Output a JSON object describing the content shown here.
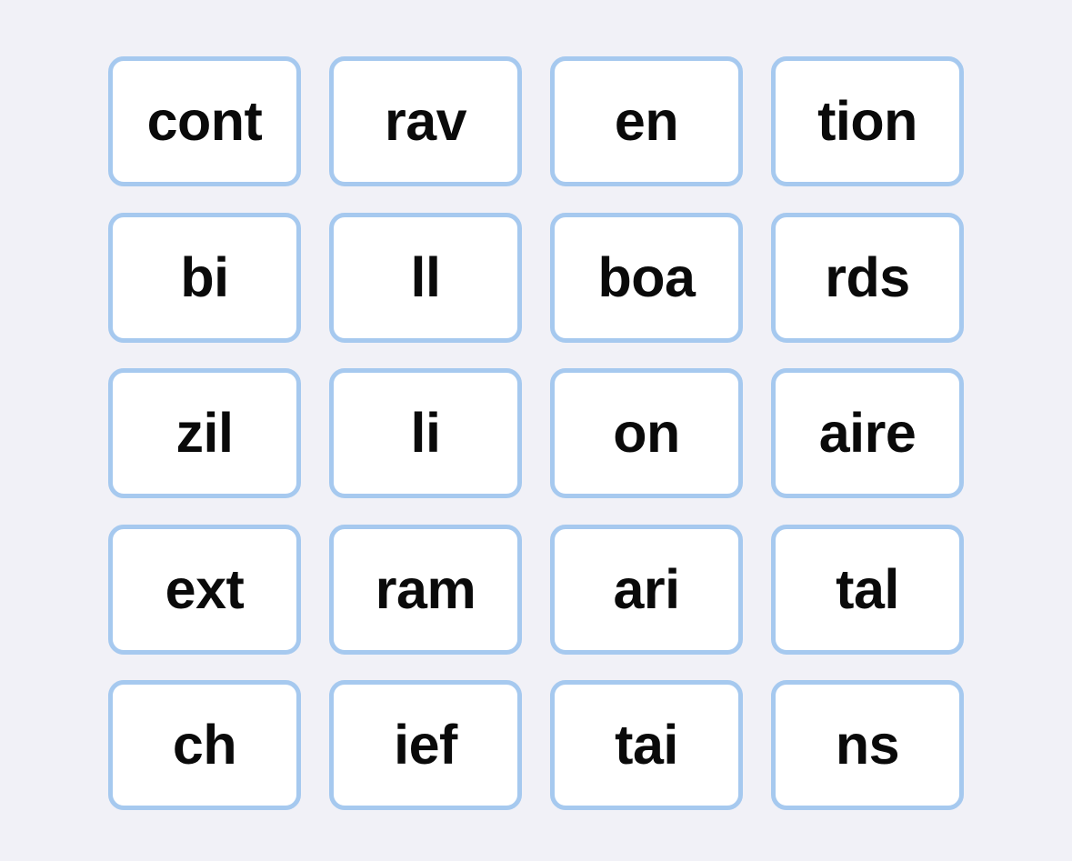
{
  "app": {
    "background_color": "#f1f1f7"
  },
  "tile_grid": {
    "columns": 4,
    "rows": 5,
    "tile_style": {
      "background_color": "#ffffff",
      "border_color": "#a6c9ef",
      "text_color": "#0a0a0a"
    },
    "tiles": [
      {
        "label": "cont"
      },
      {
        "label": "rav"
      },
      {
        "label": "en"
      },
      {
        "label": "tion"
      },
      {
        "label": "bi"
      },
      {
        "label": "ll"
      },
      {
        "label": "boa"
      },
      {
        "label": "rds"
      },
      {
        "label": "zil"
      },
      {
        "label": "li"
      },
      {
        "label": "on"
      },
      {
        "label": "aire"
      },
      {
        "label": "ext"
      },
      {
        "label": "ram"
      },
      {
        "label": "ari"
      },
      {
        "label": "tal"
      },
      {
        "label": "ch"
      },
      {
        "label": "ief"
      },
      {
        "label": "tai"
      },
      {
        "label": "ns"
      }
    ]
  }
}
